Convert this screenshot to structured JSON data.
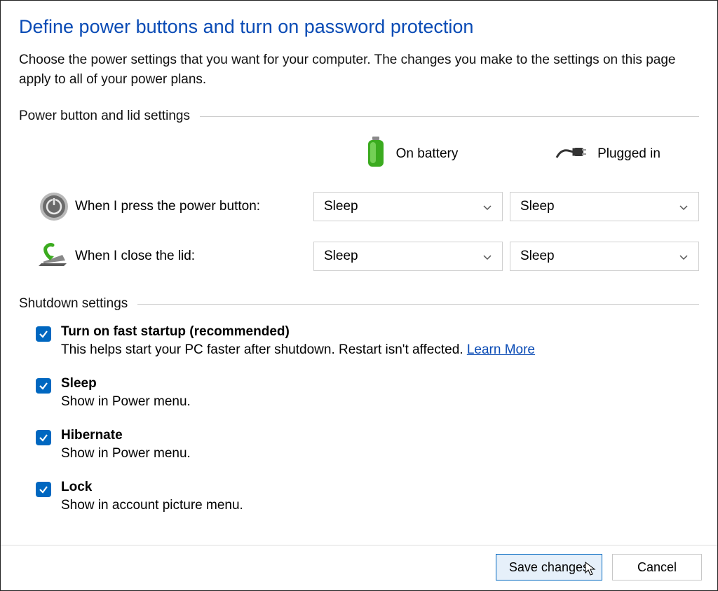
{
  "title": "Define power buttons and turn on password protection",
  "description": "Choose the power settings that you want for your computer. The changes you make to the settings on this page apply to all of your power plans.",
  "sections": {
    "power_lid": {
      "header": "Power button and lid settings",
      "cols": {
        "battery": "On battery",
        "plugged": "Plugged in"
      },
      "rows": {
        "power_button": {
          "label": "When I press the power button:",
          "battery_value": "Sleep",
          "plugged_value": "Sleep"
        },
        "close_lid": {
          "label": "When I close the lid:",
          "battery_value": "Sleep",
          "plugged_value": "Sleep"
        }
      }
    },
    "shutdown": {
      "header": "Shutdown settings",
      "items": {
        "fast_startup": {
          "title": "Turn on fast startup (recommended)",
          "sub": "This helps start your PC faster after shutdown. Restart isn't affected. ",
          "link": "Learn More",
          "checked": true
        },
        "sleep": {
          "title": "Sleep",
          "sub": "Show in Power menu.",
          "checked": true
        },
        "hibernate": {
          "title": "Hibernate",
          "sub": "Show in Power menu.",
          "checked": true
        },
        "lock": {
          "title": "Lock",
          "sub": "Show in account picture menu.",
          "checked": true
        }
      }
    }
  },
  "footer": {
    "save": "Save changes",
    "cancel": "Cancel"
  }
}
